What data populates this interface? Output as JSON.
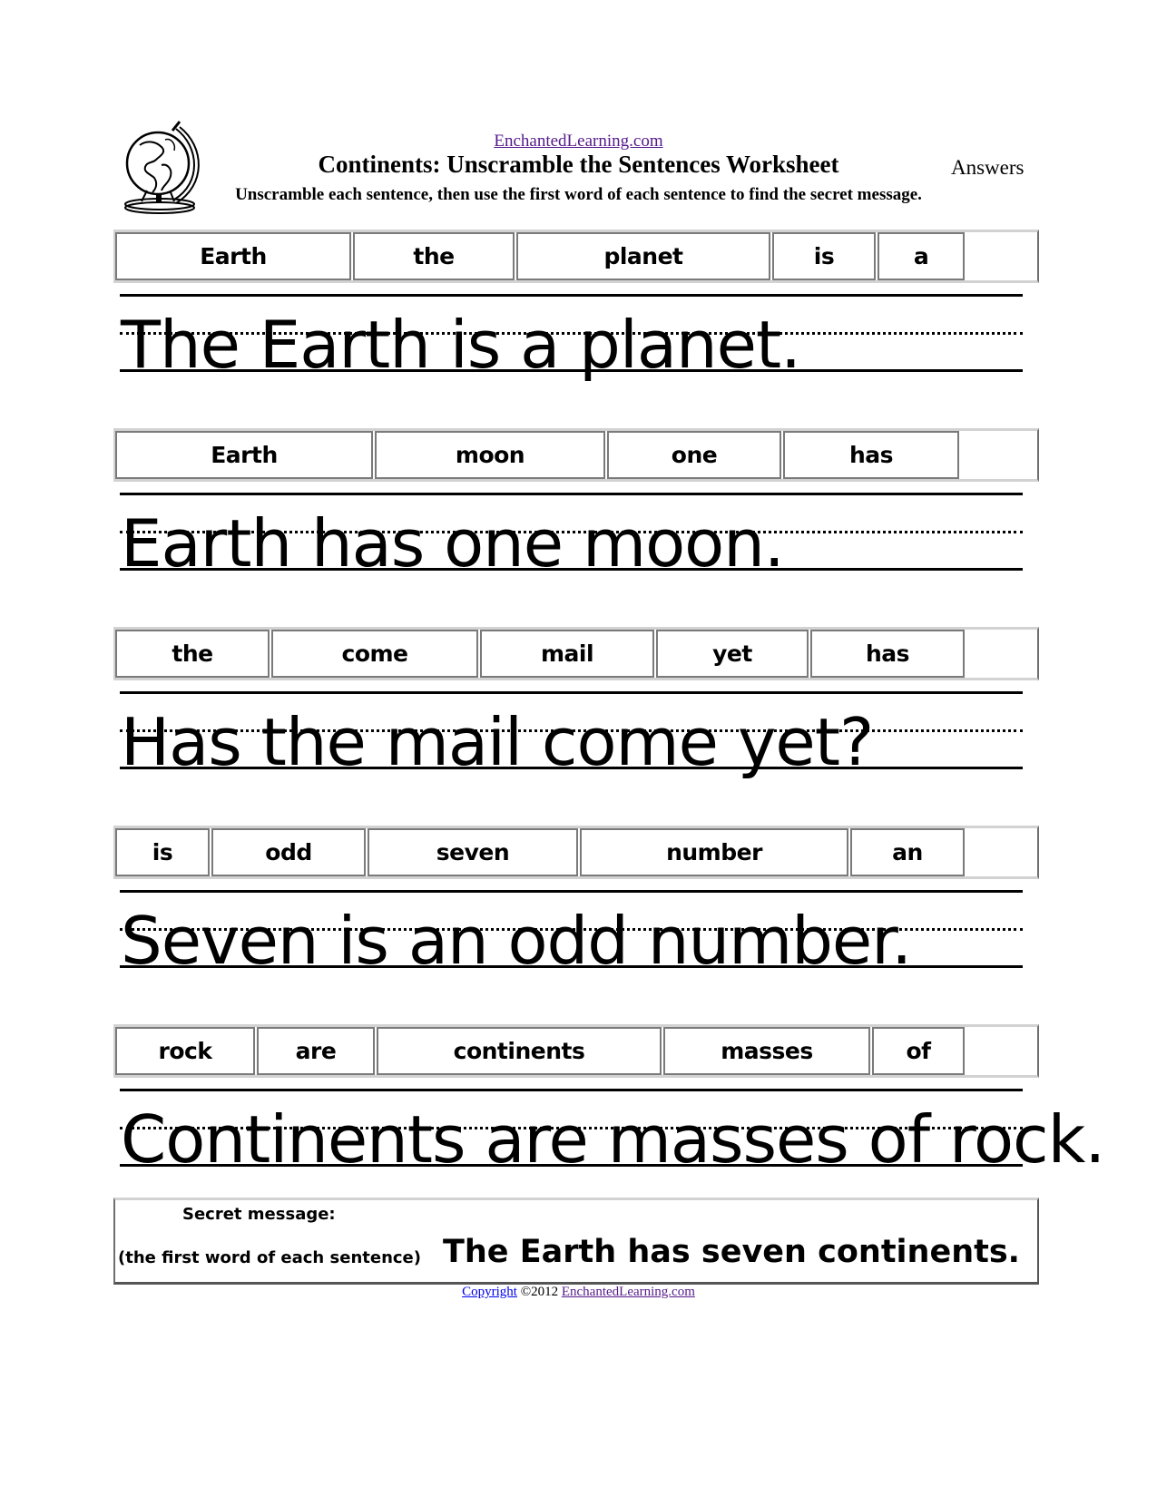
{
  "header": {
    "site_link": "EnchantedLearning.com",
    "title": "Continents: Unscramble the Sentences Worksheet",
    "answers_label": "Answers",
    "instructions": "Unscramble each sentence, then use the first word of each sentence to find the secret message.",
    "logo_icon": "globe-icon"
  },
  "exercises": [
    {
      "scrambled_words": [
        "Earth",
        "the",
        "planet",
        "is",
        "a"
      ],
      "answer": "The Earth is a planet."
    },
    {
      "scrambled_words": [
        "Earth",
        "moon",
        "one",
        "has"
      ],
      "answer": "Earth has one moon."
    },
    {
      "scrambled_words": [
        "the",
        "come",
        "mail",
        "yet",
        "has"
      ],
      "answer": "Has the mail come yet?"
    },
    {
      "scrambled_words": [
        "is",
        "odd",
        "seven",
        "number",
        "an"
      ],
      "answer": "Seven is an odd number."
    },
    {
      "scrambled_words": [
        "rock",
        "are",
        "continents",
        "masses",
        "of"
      ],
      "answer": "Continents are masses of rock."
    }
  ],
  "secret": {
    "label": "Secret message:",
    "hint": "(the first word of each sentence)",
    "message": "The Earth has seven continents."
  },
  "footer": {
    "copyright_link": "Copyright",
    "year_text": "©2012",
    "site_link": "EnchantedLearning.com"
  },
  "colors": {
    "visited_link": "#551a8b",
    "link": "#0000ee",
    "text": "#000000"
  }
}
